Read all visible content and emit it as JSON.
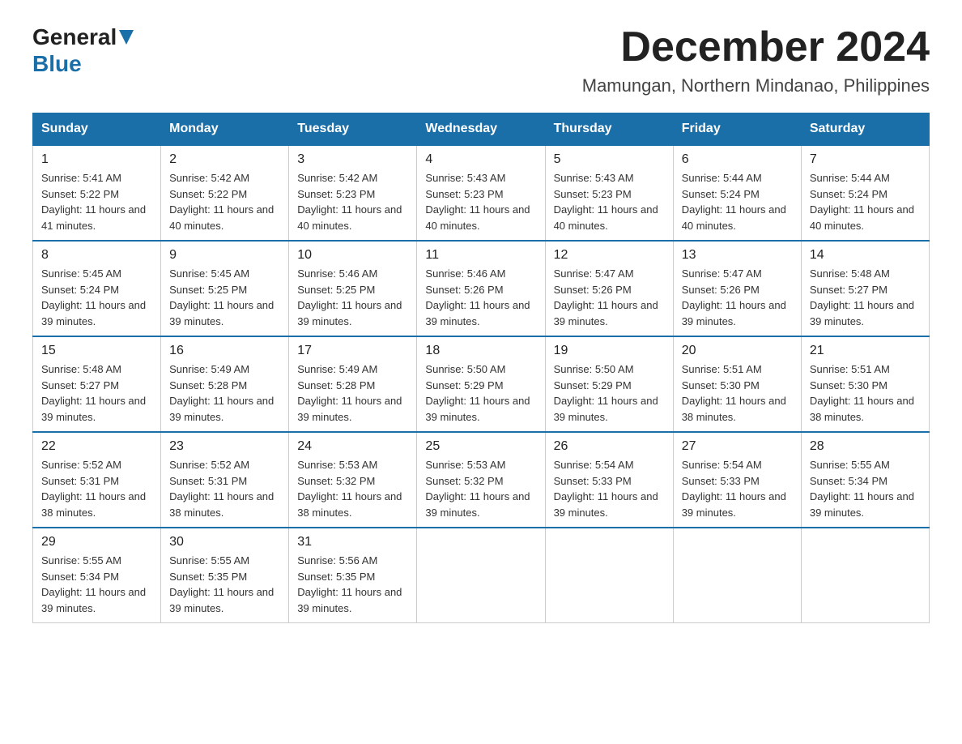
{
  "logo": {
    "general": "General",
    "blue": "Blue"
  },
  "title": "December 2024",
  "location": "Mamungan, Northern Mindanao, Philippines",
  "days_of_week": [
    "Sunday",
    "Monday",
    "Tuesday",
    "Wednesday",
    "Thursday",
    "Friday",
    "Saturday"
  ],
  "weeks": [
    [
      {
        "day": "1",
        "sunrise": "5:41 AM",
        "sunset": "5:22 PM",
        "daylight": "11 hours and 41 minutes."
      },
      {
        "day": "2",
        "sunrise": "5:42 AM",
        "sunset": "5:22 PM",
        "daylight": "11 hours and 40 minutes."
      },
      {
        "day": "3",
        "sunrise": "5:42 AM",
        "sunset": "5:23 PM",
        "daylight": "11 hours and 40 minutes."
      },
      {
        "day": "4",
        "sunrise": "5:43 AM",
        "sunset": "5:23 PM",
        "daylight": "11 hours and 40 minutes."
      },
      {
        "day": "5",
        "sunrise": "5:43 AM",
        "sunset": "5:23 PM",
        "daylight": "11 hours and 40 minutes."
      },
      {
        "day": "6",
        "sunrise": "5:44 AM",
        "sunset": "5:24 PM",
        "daylight": "11 hours and 40 minutes."
      },
      {
        "day": "7",
        "sunrise": "5:44 AM",
        "sunset": "5:24 PM",
        "daylight": "11 hours and 40 minutes."
      }
    ],
    [
      {
        "day": "8",
        "sunrise": "5:45 AM",
        "sunset": "5:24 PM",
        "daylight": "11 hours and 39 minutes."
      },
      {
        "day": "9",
        "sunrise": "5:45 AM",
        "sunset": "5:25 PM",
        "daylight": "11 hours and 39 minutes."
      },
      {
        "day": "10",
        "sunrise": "5:46 AM",
        "sunset": "5:25 PM",
        "daylight": "11 hours and 39 minutes."
      },
      {
        "day": "11",
        "sunrise": "5:46 AM",
        "sunset": "5:26 PM",
        "daylight": "11 hours and 39 minutes."
      },
      {
        "day": "12",
        "sunrise": "5:47 AM",
        "sunset": "5:26 PM",
        "daylight": "11 hours and 39 minutes."
      },
      {
        "day": "13",
        "sunrise": "5:47 AM",
        "sunset": "5:26 PM",
        "daylight": "11 hours and 39 minutes."
      },
      {
        "day": "14",
        "sunrise": "5:48 AM",
        "sunset": "5:27 PM",
        "daylight": "11 hours and 39 minutes."
      }
    ],
    [
      {
        "day": "15",
        "sunrise": "5:48 AM",
        "sunset": "5:27 PM",
        "daylight": "11 hours and 39 minutes."
      },
      {
        "day": "16",
        "sunrise": "5:49 AM",
        "sunset": "5:28 PM",
        "daylight": "11 hours and 39 minutes."
      },
      {
        "day": "17",
        "sunrise": "5:49 AM",
        "sunset": "5:28 PM",
        "daylight": "11 hours and 39 minutes."
      },
      {
        "day": "18",
        "sunrise": "5:50 AM",
        "sunset": "5:29 PM",
        "daylight": "11 hours and 39 minutes."
      },
      {
        "day": "19",
        "sunrise": "5:50 AM",
        "sunset": "5:29 PM",
        "daylight": "11 hours and 39 minutes."
      },
      {
        "day": "20",
        "sunrise": "5:51 AM",
        "sunset": "5:30 PM",
        "daylight": "11 hours and 38 minutes."
      },
      {
        "day": "21",
        "sunrise": "5:51 AM",
        "sunset": "5:30 PM",
        "daylight": "11 hours and 38 minutes."
      }
    ],
    [
      {
        "day": "22",
        "sunrise": "5:52 AM",
        "sunset": "5:31 PM",
        "daylight": "11 hours and 38 minutes."
      },
      {
        "day": "23",
        "sunrise": "5:52 AM",
        "sunset": "5:31 PM",
        "daylight": "11 hours and 38 minutes."
      },
      {
        "day": "24",
        "sunrise": "5:53 AM",
        "sunset": "5:32 PM",
        "daylight": "11 hours and 38 minutes."
      },
      {
        "day": "25",
        "sunrise": "5:53 AM",
        "sunset": "5:32 PM",
        "daylight": "11 hours and 39 minutes."
      },
      {
        "day": "26",
        "sunrise": "5:54 AM",
        "sunset": "5:33 PM",
        "daylight": "11 hours and 39 minutes."
      },
      {
        "day": "27",
        "sunrise": "5:54 AM",
        "sunset": "5:33 PM",
        "daylight": "11 hours and 39 minutes."
      },
      {
        "day": "28",
        "sunrise": "5:55 AM",
        "sunset": "5:34 PM",
        "daylight": "11 hours and 39 minutes."
      }
    ],
    [
      {
        "day": "29",
        "sunrise": "5:55 AM",
        "sunset": "5:34 PM",
        "daylight": "11 hours and 39 minutes."
      },
      {
        "day": "30",
        "sunrise": "5:55 AM",
        "sunset": "5:35 PM",
        "daylight": "11 hours and 39 minutes."
      },
      {
        "day": "31",
        "sunrise": "5:56 AM",
        "sunset": "5:35 PM",
        "daylight": "11 hours and 39 minutes."
      },
      null,
      null,
      null,
      null
    ]
  ]
}
